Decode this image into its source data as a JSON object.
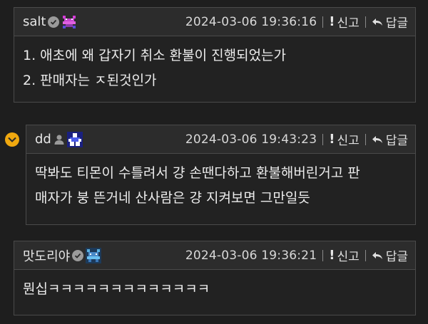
{
  "comments": [
    {
      "author": "salt",
      "verified": true,
      "timestamp": "2024-03-06 19:36:16",
      "report_label": "신고",
      "reply_label": "답글",
      "lines": [
        "1. 애초에 왜 갑자기 취소 환불이 진행되었는가",
        "2. 판매자는 ㅈ된것인가"
      ]
    },
    {
      "author": "dd",
      "verified": false,
      "timestamp": "2024-03-06 19:43:23",
      "report_label": "신고",
      "reply_label": "답글",
      "lines": [
        "딱봐도 티몬이 수틀려서 걍 손땐다하고 환불해버린거고 판",
        "매자가 붕 뜬거네 산사람은 걍 지켜보면 그만일듯"
      ]
    },
    {
      "author": "맛도리야",
      "verified": true,
      "timestamp": "2024-03-06 19:36:21",
      "report_label": "신고",
      "reply_label": "답글",
      "lines": [
        "뭔십ㅋㅋㅋㅋㅋㅋㅋㅋㅋㅋㅋㅋㅋ"
      ]
    }
  ],
  "colors": {
    "background": "#1e1e1e",
    "header_bg": "#2c2c2c",
    "border": "#4a4a4a",
    "reply_marker": "#f0a80f"
  },
  "icons": [
    "verified-check-icon",
    "pixel-avatar-icon",
    "person-icon",
    "report-exclamation-icon",
    "reply-arrow-icon",
    "reply-indent-chevron-icon"
  ]
}
